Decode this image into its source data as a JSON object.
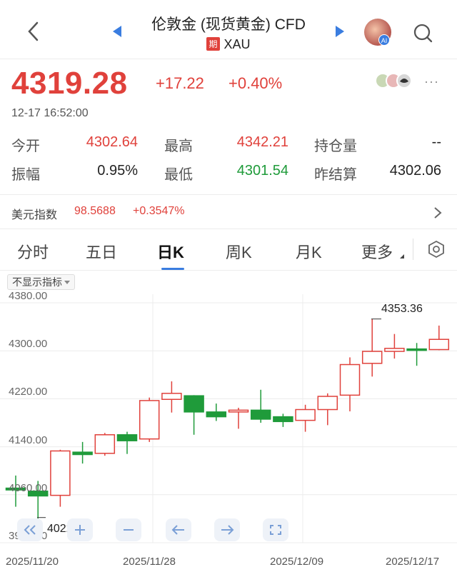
{
  "header": {
    "title": "伦敦金 (现货黄金) CFD",
    "badge": "期",
    "symbol": "XAU",
    "avatar_badge": "AI"
  },
  "quote": {
    "price": "4319.28",
    "change": "+17.22",
    "change_pct": "+0.40%",
    "time": "12-17 16:52:00",
    "more_label": "···"
  },
  "stats": {
    "open_label": "今开",
    "open": "4302.64",
    "high_label": "最高",
    "high": "4342.21",
    "oi_label": "持仓量",
    "oi": "--",
    "amp_label": "振幅",
    "amp": "0.95%",
    "low_label": "最低",
    "low": "4301.54",
    "prev_label": "昨结算",
    "prev": "4302.06"
  },
  "usd_index": {
    "label": "美元指数",
    "value": "98.5688",
    "change_pct": "+0.3547%"
  },
  "tabs": [
    {
      "label": "分时"
    },
    {
      "label": "五日"
    },
    {
      "label": "日K",
      "active": true
    },
    {
      "label": "周K"
    },
    {
      "label": "月K"
    },
    {
      "label": "更多"
    }
  ],
  "indicator_button": "不显示指标",
  "colors": {
    "up": "#e0413b",
    "down": "#1f9b3a",
    "accent": "#3a7de0"
  },
  "chart_data": {
    "type": "candlestick",
    "y_ticks": [
      "4380.00",
      "4300.00",
      "4220.00",
      "4140.00",
      "4060.00",
      "3980.00"
    ],
    "ylim": [
      3980,
      4380
    ],
    "x_ticks": [
      "2025/11/20",
      "2025/11/28",
      "2025/12/09",
      "2025/12/17"
    ],
    "annotations": {
      "max": "4353.36",
      "min": "4022.63"
    },
    "candles": [
      {
        "o": 4071,
        "h": 4092,
        "l": 4040,
        "c": 4068
      },
      {
        "o": 4066,
        "h": 4083,
        "l": 4020,
        "c": 4058
      },
      {
        "o": 4059,
        "h": 4135,
        "l": 4040,
        "c": 4133
      },
      {
        "o": 4131,
        "h": 4148,
        "l": 4112,
        "c": 4127
      },
      {
        "o": 4129,
        "h": 4163,
        "l": 4125,
        "c": 4160
      },
      {
        "o": 4160,
        "h": 4165,
        "l": 4128,
        "c": 4150
      },
      {
        "o": 4153,
        "h": 4222,
        "l": 4148,
        "c": 4217
      },
      {
        "o": 4219,
        "h": 4249,
        "l": 4197,
        "c": 4229
      },
      {
        "o": 4225,
        "h": 4226,
        "l": 4160,
        "c": 4198
      },
      {
        "o": 4198,
        "h": 4212,
        "l": 4183,
        "c": 4190
      },
      {
        "o": 4198,
        "h": 4205,
        "l": 4170,
        "c": 4201
      },
      {
        "o": 4201,
        "h": 4235,
        "l": 4180,
        "c": 4186
      },
      {
        "o": 4190,
        "h": 4195,
        "l": 4173,
        "c": 4182
      },
      {
        "o": 4184,
        "h": 4210,
        "l": 4165,
        "c": 4202
      },
      {
        "o": 4202,
        "h": 4229,
        "l": 4176,
        "c": 4224
      },
      {
        "o": 4226,
        "h": 4289,
        "l": 4199,
        "c": 4277
      },
      {
        "o": 4279,
        "h": 4353,
        "l": 4257,
        "c": 4299
      },
      {
        "o": 4299,
        "h": 4328,
        "l": 4287,
        "c": 4304
      },
      {
        "o": 4303,
        "h": 4313,
        "l": 4275,
        "c": 4301
      },
      {
        "o": 4302,
        "h": 4342,
        "l": 4301,
        "c": 4319
      }
    ]
  }
}
